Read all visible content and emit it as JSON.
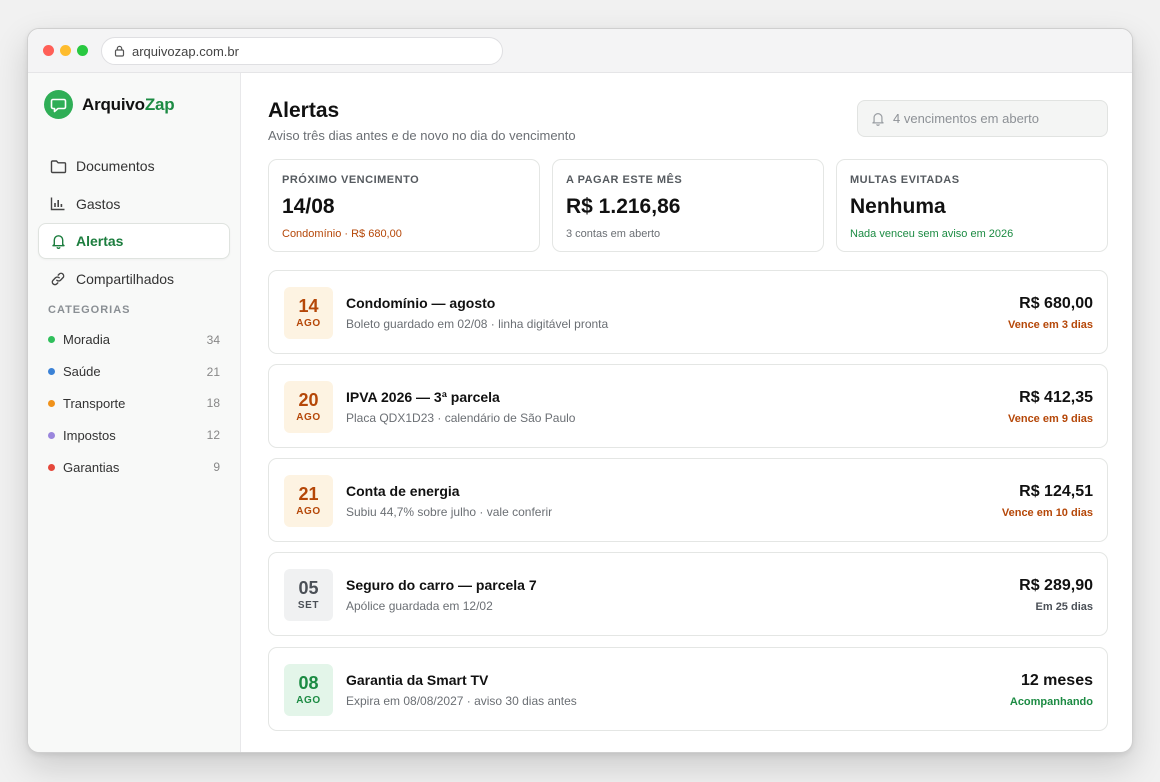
{
  "browser": {
    "url": "arquivozap.com.br"
  },
  "brand": {
    "name_part1": "Arquivo",
    "name_part2": "Zap",
    "color": "#2fae56"
  },
  "sidebar": {
    "items": [
      {
        "label": "Documentos",
        "icon": "folder-icon"
      },
      {
        "label": "Gastos",
        "icon": "bar-chart-icon"
      },
      {
        "label": "Alertas",
        "icon": "bell-icon",
        "active": true
      },
      {
        "label": "Compartilhados",
        "icon": "link-icon"
      }
    ],
    "categories_title": "CATEGORIAS",
    "categories": [
      {
        "label": "Moradia",
        "count": "34",
        "color": "#2fbf5b"
      },
      {
        "label": "Saúde",
        "count": "21",
        "color": "#3b82d6"
      },
      {
        "label": "Transporte",
        "count": "18",
        "color": "#f0921b"
      },
      {
        "label": "Impostos",
        "count": "12",
        "color": "#9a86dd"
      },
      {
        "label": "Garantias",
        "count": "9",
        "color": "#e5483b"
      }
    ]
  },
  "header": {
    "title": "Alertas",
    "subtitle": "Aviso três dias antes e de novo no dia do vencimento",
    "pill": "4 vencimentos em aberto"
  },
  "stats": [
    {
      "label": "PRÓXIMO VENCIMENTO",
      "value": "14/08",
      "note": "Condomínio · R$ 680,00",
      "note_color": "#b54708"
    },
    {
      "label": "A PAGAR ESTE MÊS",
      "value": "R$ 1.216,86",
      "note": "3 contas em aberto",
      "note_color": "#6b6f74"
    },
    {
      "label": "MULTAS EVITADAS",
      "value": "Nenhuma",
      "note": "Nada venceu sem aviso em 2026",
      "note_color": "#1c8b43"
    }
  ],
  "alerts": [
    {
      "day": "14",
      "month": "AGO",
      "title": "Condomínio — agosto",
      "desc": "Boleto guardado em 02/08 · linha digitável pronta",
      "amount": "R$ 680,00",
      "status": "Vence em 3 dias",
      "tone": "warn"
    },
    {
      "day": "20",
      "month": "AGO",
      "title": "IPVA 2026 — 3ª parcela",
      "desc": "Placa QDX1D23 · calendário de São Paulo",
      "amount": "R$ 412,35",
      "status": "Vence em 9 dias",
      "tone": "warn"
    },
    {
      "day": "21",
      "month": "AGO",
      "title": "Conta de energia",
      "desc": "Subiu 44,7% sobre julho · vale conferir",
      "amount": "R$ 124,51",
      "status": "Vence em 10 dias",
      "tone": "warn"
    },
    {
      "day": "05",
      "month": "SET",
      "title": "Seguro do carro — parcela 7",
      "desc": "Apólice guardada em 12/02",
      "amount": "R$ 289,90",
      "status": "Em 25 dias",
      "tone": "neutral"
    },
    {
      "day": "08",
      "month": "AGO",
      "title": "Garantia da Smart TV",
      "desc": "Expira em 08/08/2027 · aviso 30 dias antes",
      "amount": "12 meses",
      "status": "Acompanhando",
      "tone": "ok"
    }
  ],
  "tones": {
    "warn": {
      "bg": "#fdf3e2",
      "fg": "#b54708"
    },
    "neutral": {
      "bg": "#f0f1f2",
      "fg": "#4b5057"
    },
    "ok": {
      "bg": "#e3f5e9",
      "fg": "#1c8b43"
    }
  }
}
